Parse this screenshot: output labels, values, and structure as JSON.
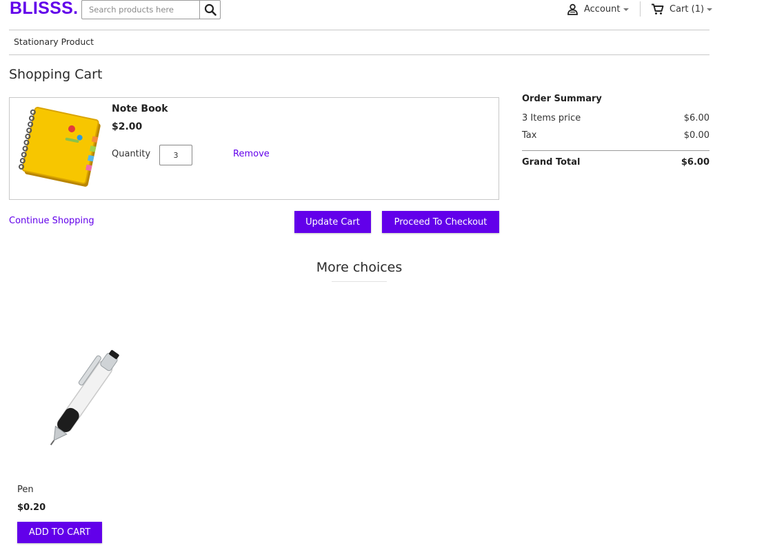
{
  "header": {
    "logo_text": "BLISSS",
    "logo_dot": ".",
    "brand_color": "#6200ea",
    "search": {
      "placeholder": "Search products here",
      "value": ""
    },
    "account_label": "Account",
    "cart_label": "Cart (1)"
  },
  "nav": {
    "category": "Stationary Product"
  },
  "page": {
    "title": "Shopping Cart"
  },
  "cart": {
    "items": [
      {
        "name": "Note Book",
        "price": "$2.00",
        "quantity_label": "Quantity",
        "quantity": "3",
        "remove_label": "Remove"
      }
    ],
    "continue_label": "Continue Shopping",
    "update_label": "Update Cart",
    "checkout_label": "Proceed To Checkout"
  },
  "summary": {
    "title": "Order Summary",
    "rows": [
      {
        "label": "3 Items price",
        "value": "$6.00"
      },
      {
        "label": "Tax",
        "value": "$0.00"
      }
    ],
    "total_label": "Grand Total",
    "total_value": "$6.00"
  },
  "more": {
    "title": "More choices",
    "products": [
      {
        "name": "Pen",
        "price": "$0.20",
        "button_label": "ADD TO CART"
      }
    ]
  },
  "icons": {
    "search": "search-icon",
    "account": "user-icon",
    "cart": "cart-icon",
    "caret": "chevron-down-icon"
  }
}
